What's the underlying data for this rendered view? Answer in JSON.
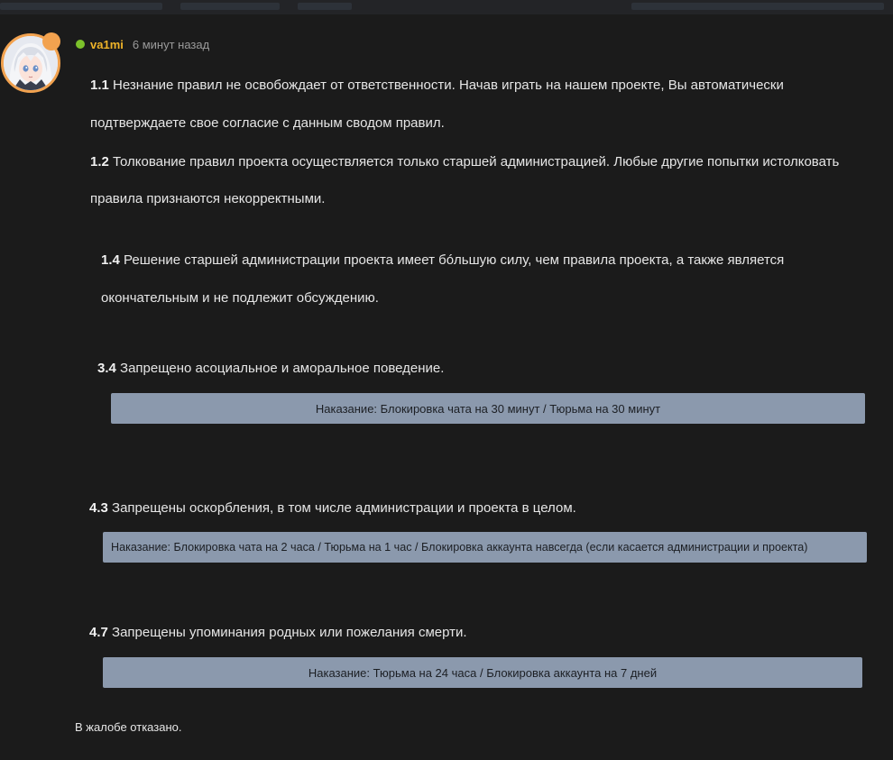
{
  "post": {
    "username": "va1mi",
    "time": "6 минут назад"
  },
  "rules": [
    {
      "num": "1.1",
      "line1": "Незнание правил не освобождает от ответственности. Начав играть на нашем проекте, Вы автоматически",
      "line2": "подтверждаете свое согласие с данным сводом правил."
    },
    {
      "num": "1.2",
      "line1": "Толкование правил проекта осуществляется только старшей администрацией. Любые другие попытки истолковать",
      "line2": "правила признаются некорректными."
    },
    {
      "num": "1.4",
      "line1": "Решение старшей администрации проекта имеет бóльшую силу, чем правила проекта, а также является",
      "line2": "окончательным и не подлежит обсуждению."
    },
    {
      "num": "3.4",
      "line1": "Запрещено асоциальное и аморальное поведение.",
      "penalty": "Наказание: Блокировка чата на 30 минут / Тюрьма на 30 минут"
    },
    {
      "num": "4.3",
      "line1": "Запрещены оскорбления, в том числе администрации и проекта в целом.",
      "penalty": "Наказание: Блокировка чата на 2 часа / Тюрьма на 1 час / Блокировка аккаунта навсегда (если касается администрации и проекта)"
    },
    {
      "num": "4.7",
      "line1": "Запрещены упоминания родных или пожелания смерти.",
      "penalty": "Наказание: Тюрьма на 24 часа / Блокировка аккаунта на 7 дней"
    }
  ],
  "verdict": "В жалобе отказано.",
  "colors": {
    "background": "#1b1b1b",
    "username": "#f0b429",
    "online": "#7cc12b",
    "avatar_ring": "#f2a24f",
    "penalty_bar": "#8b99ad"
  }
}
